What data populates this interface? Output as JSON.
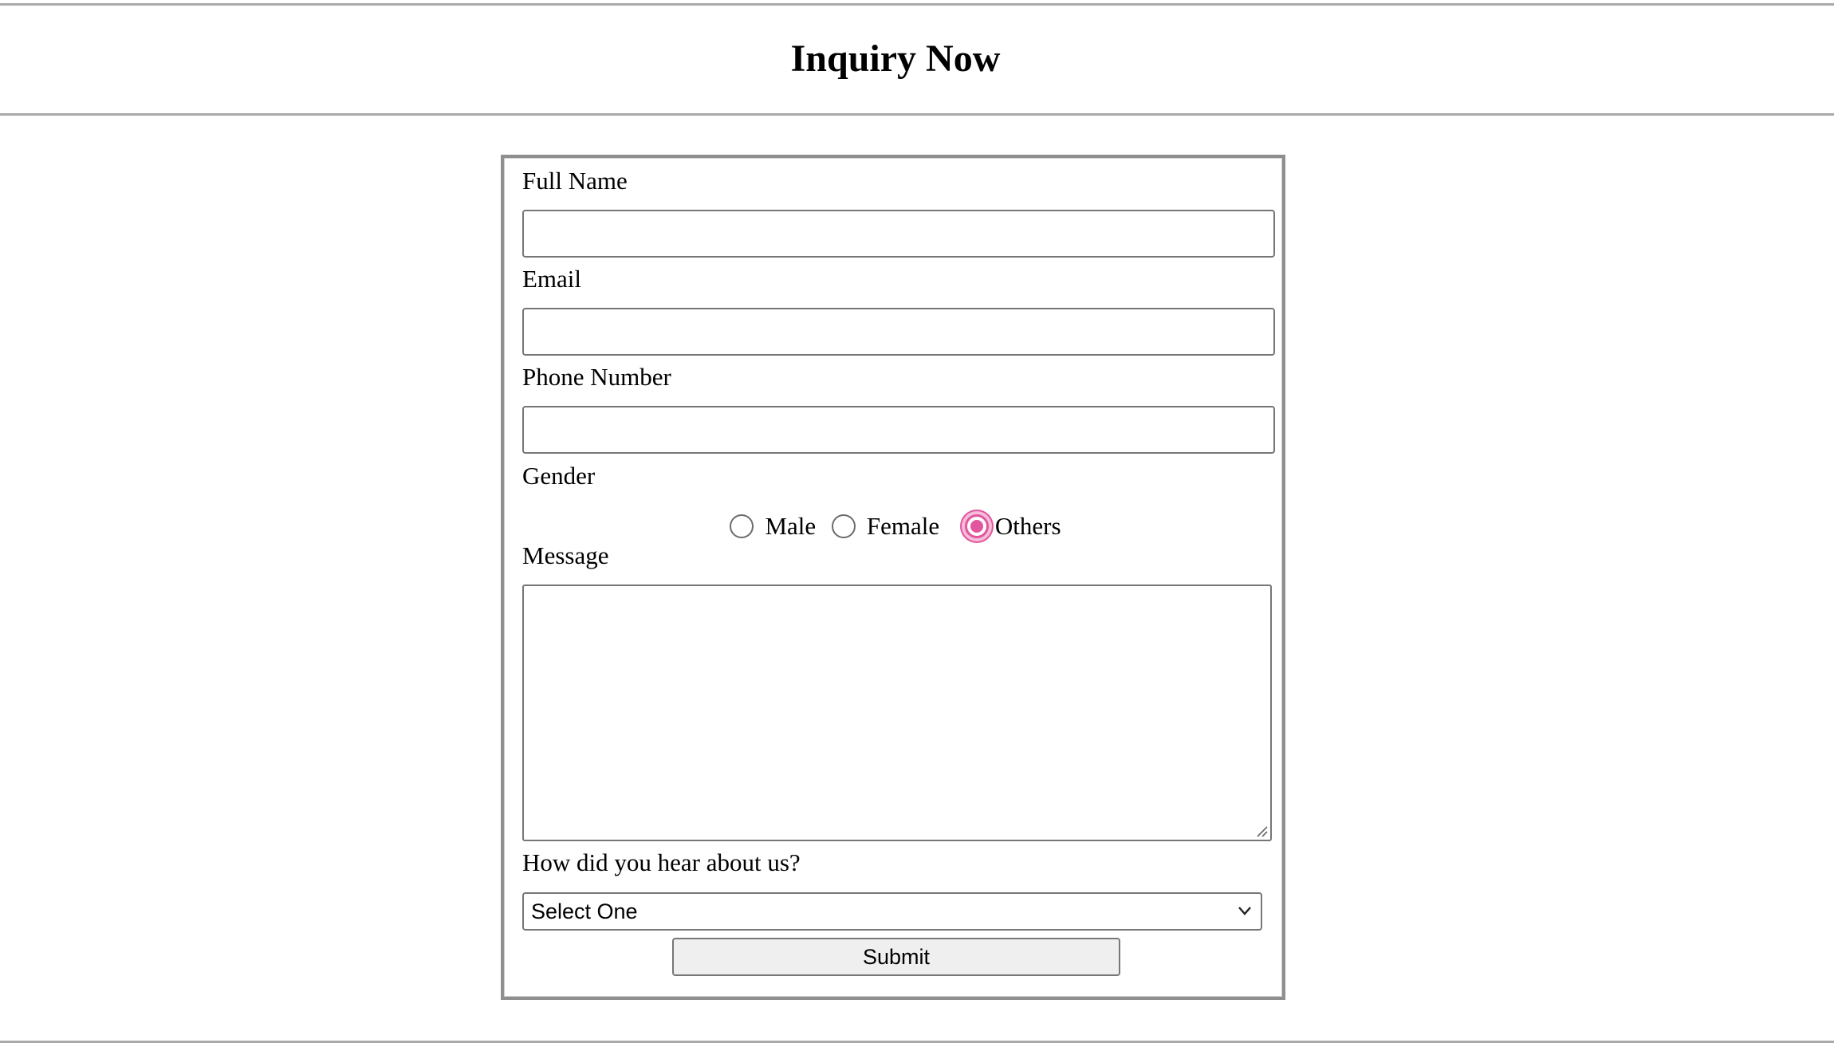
{
  "page": {
    "title": "Inquiry Now"
  },
  "form": {
    "full_name": {
      "label": "Full Name",
      "value": ""
    },
    "email": {
      "label": "Email",
      "value": ""
    },
    "phone": {
      "label": "Phone Number",
      "value": ""
    },
    "gender": {
      "label": "Gender",
      "options": [
        "Male",
        "Female",
        "Others"
      ],
      "selected": "Others"
    },
    "message": {
      "label": "Message",
      "value": ""
    },
    "source": {
      "label": "How did you hear about us?",
      "selected": "Select One"
    },
    "submit_label": "Submit"
  },
  "colors": {
    "radio_accent": "#e2559f",
    "border": "#767676",
    "button_bg": "#efefef"
  }
}
